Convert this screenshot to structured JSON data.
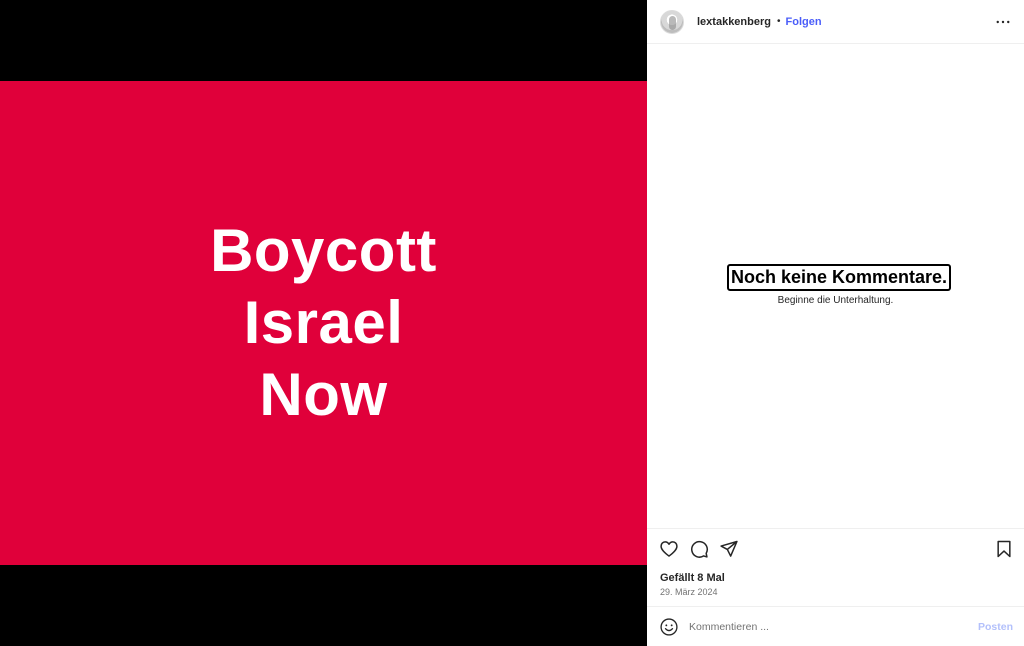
{
  "post": {
    "text_lines": [
      "Boycott",
      "Israel",
      "Now"
    ],
    "background_color": "#e0003a"
  },
  "header": {
    "username": "lextakkenberg",
    "separator": "•",
    "follow_label": "Folgen",
    "more_icon": "more-horizontal-icon"
  },
  "comments": {
    "empty_title": "Noch keine Kommentare.",
    "empty_subtitle": "Beginne die Unterhaltung."
  },
  "actions": {
    "icons": [
      "heart-icon",
      "comment-icon",
      "share-icon",
      "bookmark-icon"
    ],
    "likes": "Gefällt 8 Mal",
    "date": "29. März 2024"
  },
  "comment_bar": {
    "emoji_icon": "emoji-icon",
    "placeholder": "Kommentieren ...",
    "post_label": "Posten"
  }
}
